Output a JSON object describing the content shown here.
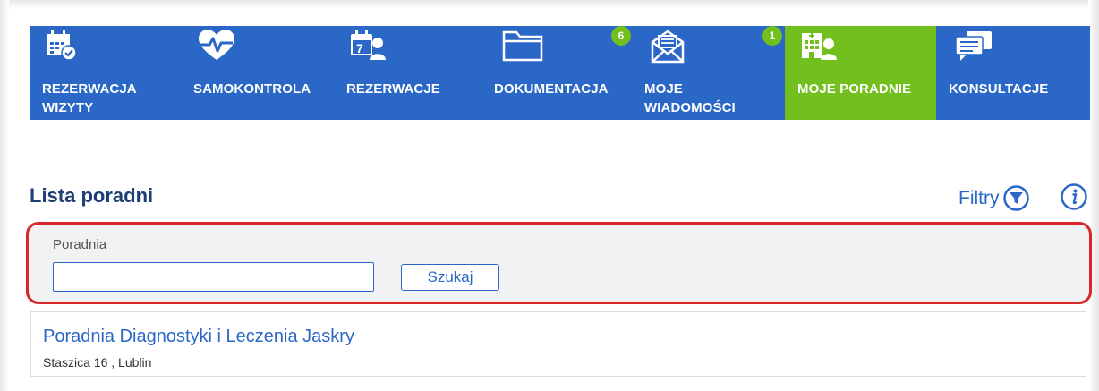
{
  "nav": {
    "items": [
      {
        "label": "REZERWACJA\nWIZYTY",
        "icon": "calendar-check-icon"
      },
      {
        "label": "SAMOKONTROLA",
        "icon": "heart-pulse-icon"
      },
      {
        "label": "REZERWACJE",
        "icon": "calendar-person-icon"
      },
      {
        "label": "DOKUMENTACJA",
        "icon": "folder-icon",
        "badge": "6"
      },
      {
        "label": "MOJE\nWIADOMOŚCI",
        "icon": "envelope-icon",
        "badge": "1"
      },
      {
        "label": "MOJE PORADNIE",
        "icon": "hospital-person-icon",
        "active": true
      },
      {
        "label": "KONSULTACJE",
        "icon": "chat-bubbles-icon"
      }
    ],
    "colors": {
      "bar": "#2a67c7",
      "active": "#73bf1e"
    }
  },
  "list": {
    "title": "Lista poradni",
    "filters_label": "Filtry"
  },
  "filter": {
    "field_label": "Poradnia",
    "field_value": "",
    "search_label": "Szukaj",
    "highlight_color": "#d9262a"
  },
  "results": [
    {
      "name": "Poradnia Diagnostyki i Leczenia Jaskry",
      "address": "Staszica 16 , Lublin"
    }
  ]
}
